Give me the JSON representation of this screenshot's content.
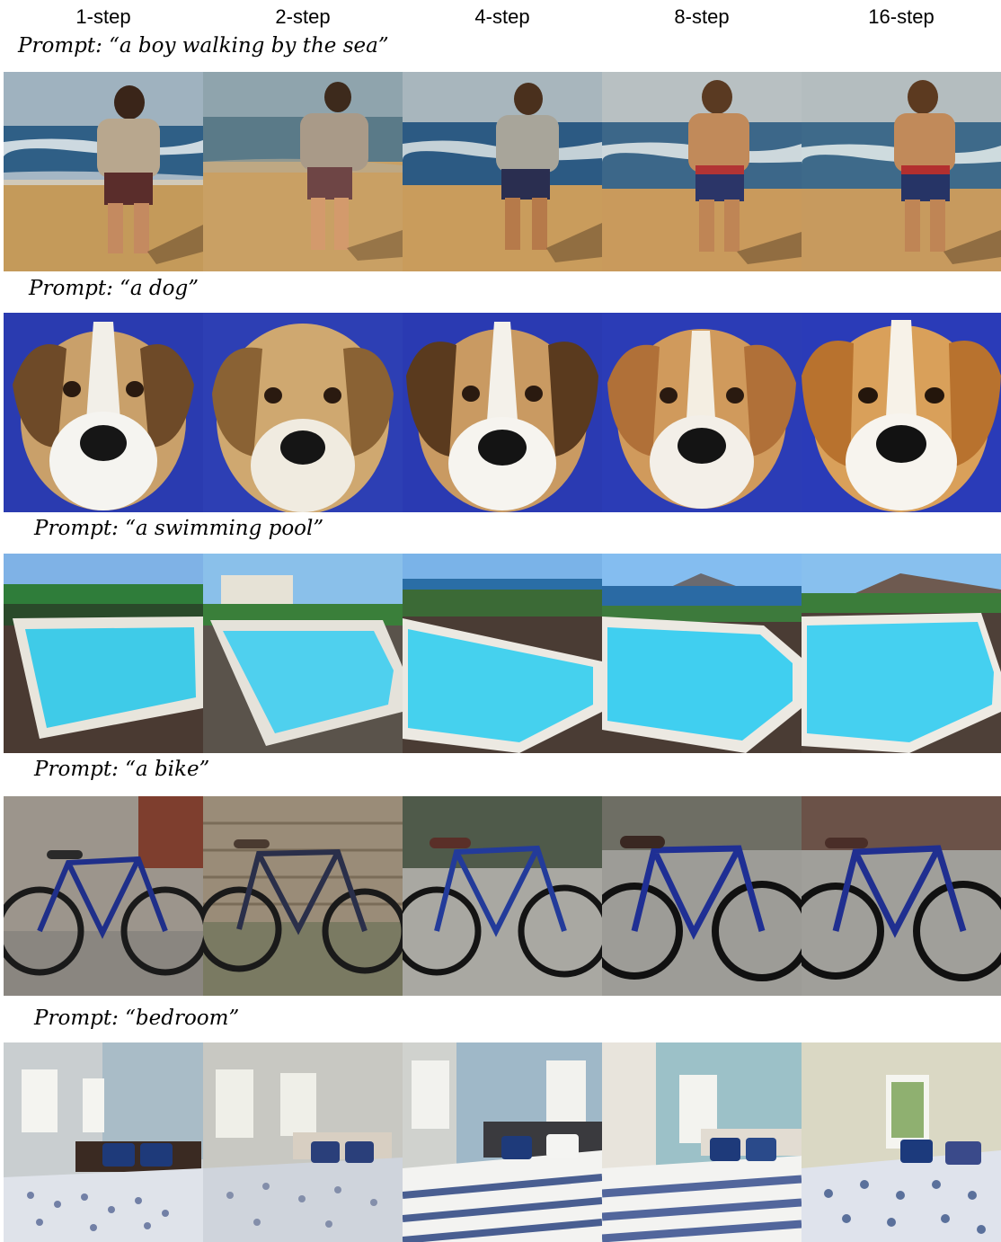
{
  "columns": [
    "1-step",
    "2-step",
    "4-step",
    "8-step",
    "16-step"
  ],
  "rows": [
    {
      "prompt": "Prompt: “a boy walking by the sea”",
      "subject": "boy-by-sea"
    },
    {
      "prompt": "Prompt: “a dog”",
      "subject": "dog-portrait"
    },
    {
      "prompt": "Prompt: “a swimming pool”",
      "subject": "swimming-pool"
    },
    {
      "prompt": "Prompt: “a bike”",
      "subject": "blue-bike"
    },
    {
      "prompt": "Prompt: “bedroom”",
      "subject": "bedroom"
    }
  ]
}
